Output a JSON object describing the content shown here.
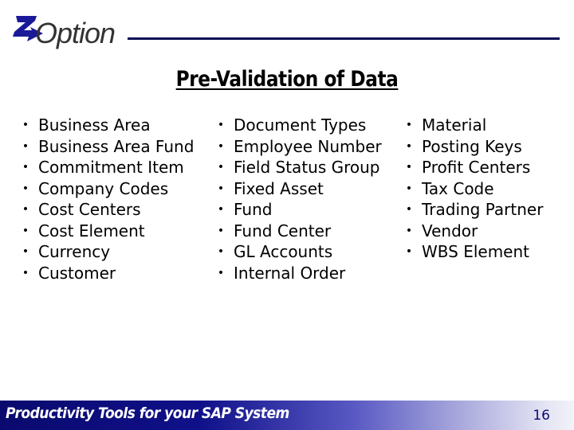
{
  "logo": {
    "letter": "Z",
    "text": "Option",
    "mark_color": "#1a1a99"
  },
  "title": "Pre-Validation of Data",
  "columns": [
    {
      "items": [
        "Business Area",
        "Business Area Fund",
        "Commitment Item",
        "Company Codes",
        "Cost Centers",
        "Cost Element",
        "Currency",
        "Customer"
      ]
    },
    {
      "items": [
        "Document Types",
        "Employee Number",
        "Field Status Group",
        "Fixed Asset",
        "Fund",
        "Fund Center",
        "GL Accounts",
        "Internal Order"
      ]
    },
    {
      "items": [
        "Material",
        "Posting Keys",
        "Profit Centers",
        "Tax Code",
        "Trading Partner",
        "Vendor",
        "WBS Element"
      ]
    }
  ],
  "bullet_glyph": "•",
  "footer": {
    "tagline": "Productivity Tools for your SAP System",
    "page_number": "16"
  },
  "colors": {
    "brand_navy": "#0b0b55",
    "footer_start": "#0a0a6e",
    "footer_end": "#f2f2f8"
  }
}
